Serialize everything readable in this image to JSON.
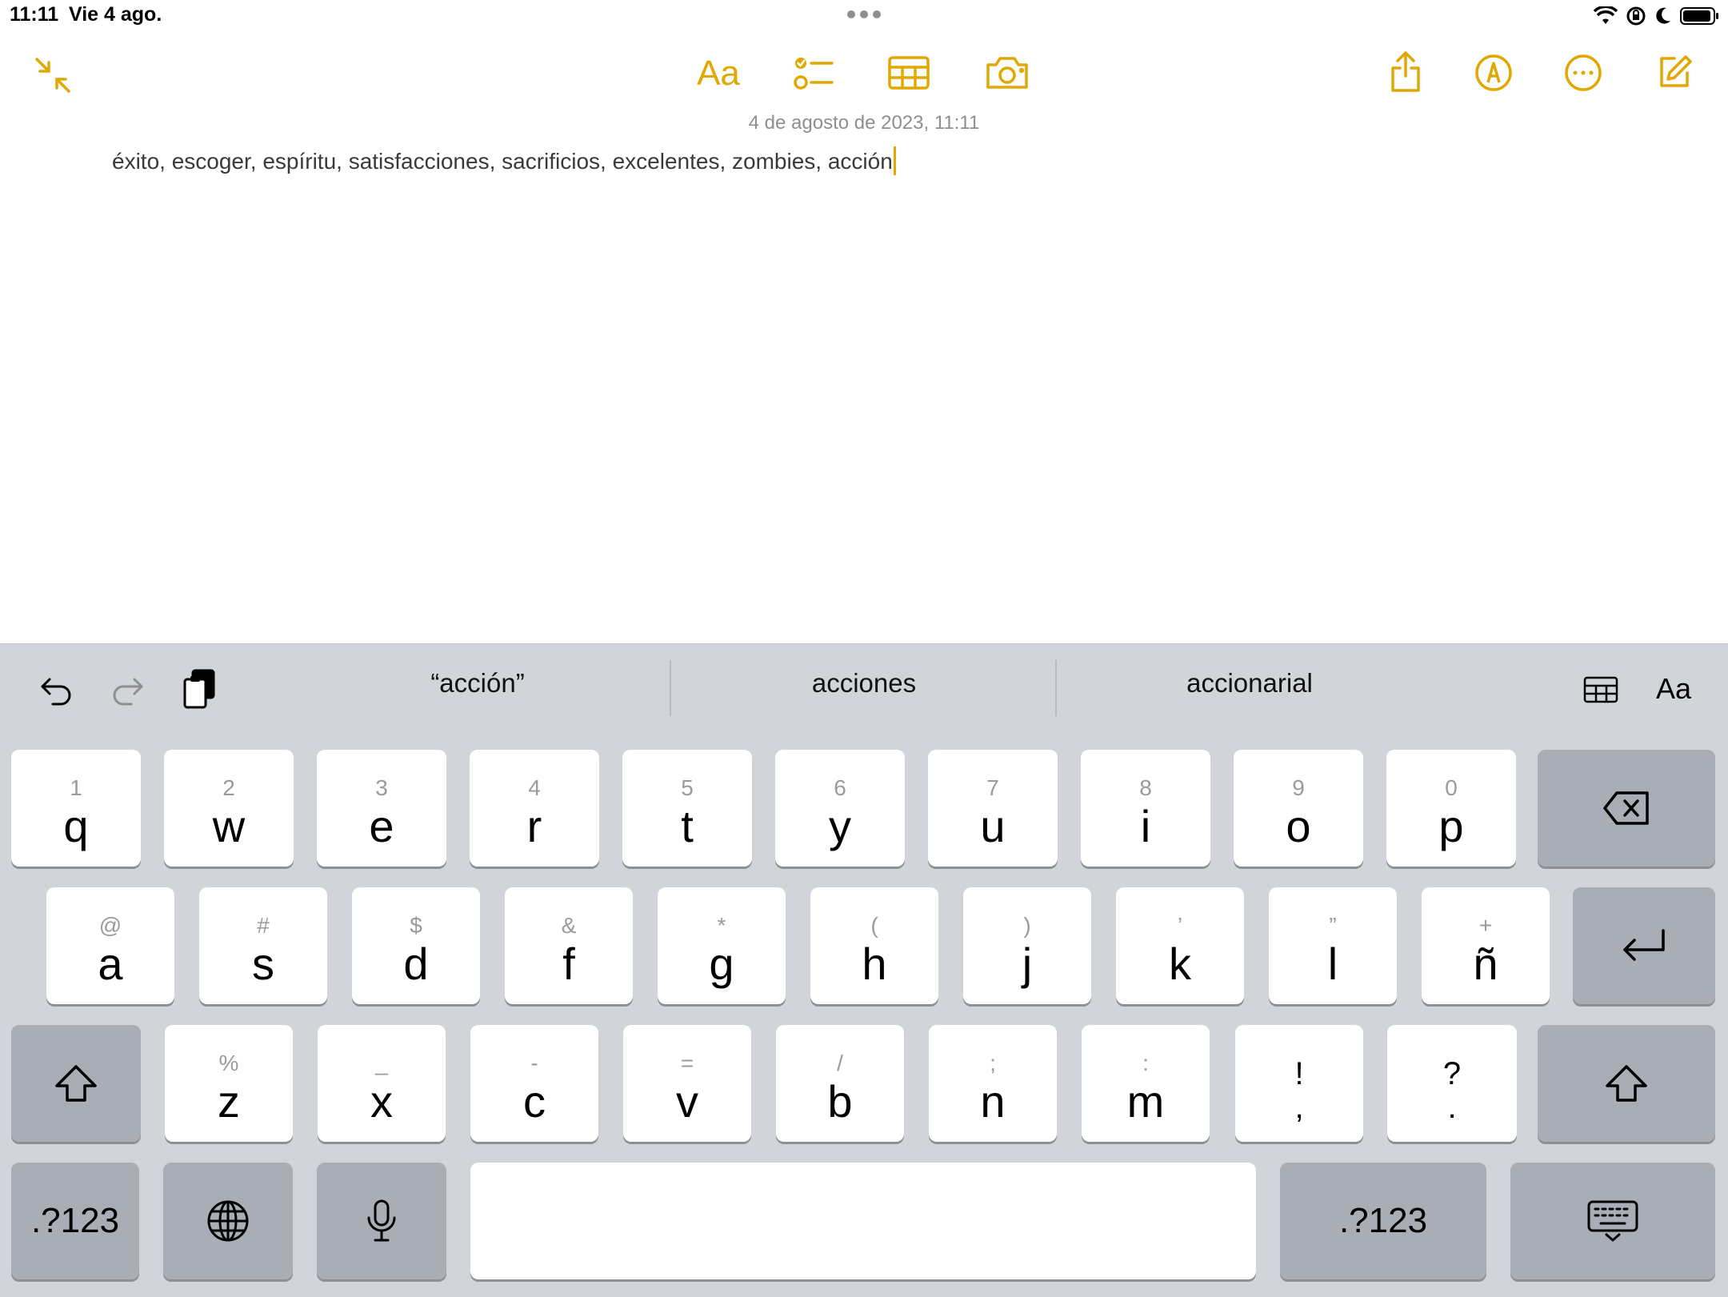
{
  "status": {
    "time": "11:11",
    "date": "Vie 4 ago."
  },
  "toolbar": {
    "format_label": "Aa",
    "accent": "#e0a800",
    "icons": [
      "collapse-icon",
      "format-icon",
      "checklist-icon",
      "table-icon",
      "camera-icon",
      "share-icon",
      "markup-icon",
      "more-icon",
      "compose-icon"
    ]
  },
  "note": {
    "date": "4 de agosto de 2023, 11:11",
    "body": "éxito, escoger, espíritu, satisfacciones, sacrificios, excelentes, zombies, acción"
  },
  "suggestions": [
    "“acción”",
    "acciones",
    "accionarial"
  ],
  "shortcut_bar": {
    "format_label": "Aa"
  },
  "keys": {
    "row1": [
      {
        "sub": "1",
        "main": "q"
      },
      {
        "sub": "2",
        "main": "w"
      },
      {
        "sub": "3",
        "main": "e"
      },
      {
        "sub": "4",
        "main": "r"
      },
      {
        "sub": "5",
        "main": "t"
      },
      {
        "sub": "6",
        "main": "y"
      },
      {
        "sub": "7",
        "main": "u"
      },
      {
        "sub": "8",
        "main": "i"
      },
      {
        "sub": "9",
        "main": "o"
      },
      {
        "sub": "0",
        "main": "p"
      }
    ],
    "row2": [
      {
        "sub": "@",
        "main": "a"
      },
      {
        "sub": "#",
        "main": "s"
      },
      {
        "sub": "$",
        "main": "d"
      },
      {
        "sub": "&",
        "main": "f"
      },
      {
        "sub": "*",
        "main": "g"
      },
      {
        "sub": "(",
        "main": "h"
      },
      {
        "sub": ")",
        "main": "j"
      },
      {
        "sub": "’",
        "main": "k"
      },
      {
        "sub": "”",
        "main": "l"
      },
      {
        "sub": "+",
        "main": "ñ"
      }
    ],
    "row3": [
      {
        "sub": "%",
        "main": "z"
      },
      {
        "sub": "_",
        "main": "x"
      },
      {
        "sub": "-",
        "main": "c"
      },
      {
        "sub": "=",
        "main": "v"
      },
      {
        "sub": "/",
        "main": "b"
      },
      {
        "sub": ";",
        "main": "n"
      },
      {
        "sub": ":",
        "main": "m"
      }
    ],
    "punct": [
      {
        "top": "!",
        "bottom": ","
      },
      {
        "top": "?",
        "bottom": "."
      }
    ],
    "numbers_label": ".?123"
  }
}
